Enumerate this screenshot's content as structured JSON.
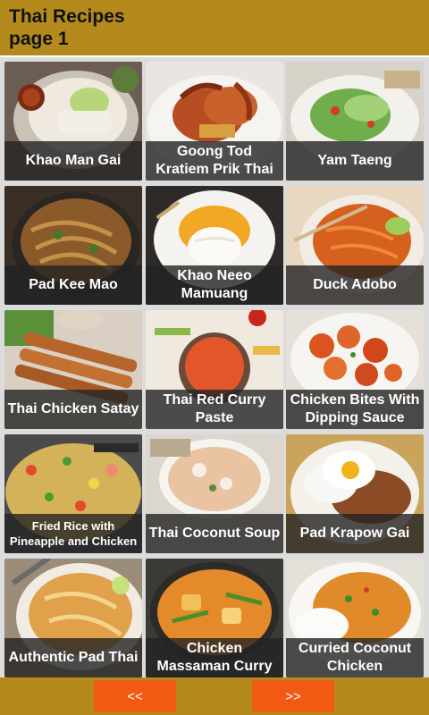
{
  "header": {
    "title_line1": "Thai Recipes",
    "title_line2": "page 1"
  },
  "recipes": [
    {
      "label": "Khao Man Gai"
    },
    {
      "label": "Goong Tod Kratiem Prik Thai"
    },
    {
      "label": "Yam Taeng"
    },
    {
      "label": "Pad Kee Mao"
    },
    {
      "label": "Khao Neeo Mamuang"
    },
    {
      "label": "Duck Adobo"
    },
    {
      "label": "Thai Chicken Satay"
    },
    {
      "label": "Thai Red Curry Paste"
    },
    {
      "label": "Chicken Bites With Dipping Sauce"
    },
    {
      "label": "Fried Rice with Pineapple and Chicken"
    },
    {
      "label": "Thai Coconut Soup"
    },
    {
      "label": "Pad Krapow Gai"
    },
    {
      "label": "Authentic Pad Thai"
    },
    {
      "label": "Chicken Massaman Curry"
    },
    {
      "label": "Curried Coconut Chicken"
    }
  ],
  "footer": {
    "prev_label": "<<",
    "next_label": ">>"
  },
  "colors": {
    "header_bg": "#b48a1c",
    "button_bg": "#f05a12"
  }
}
